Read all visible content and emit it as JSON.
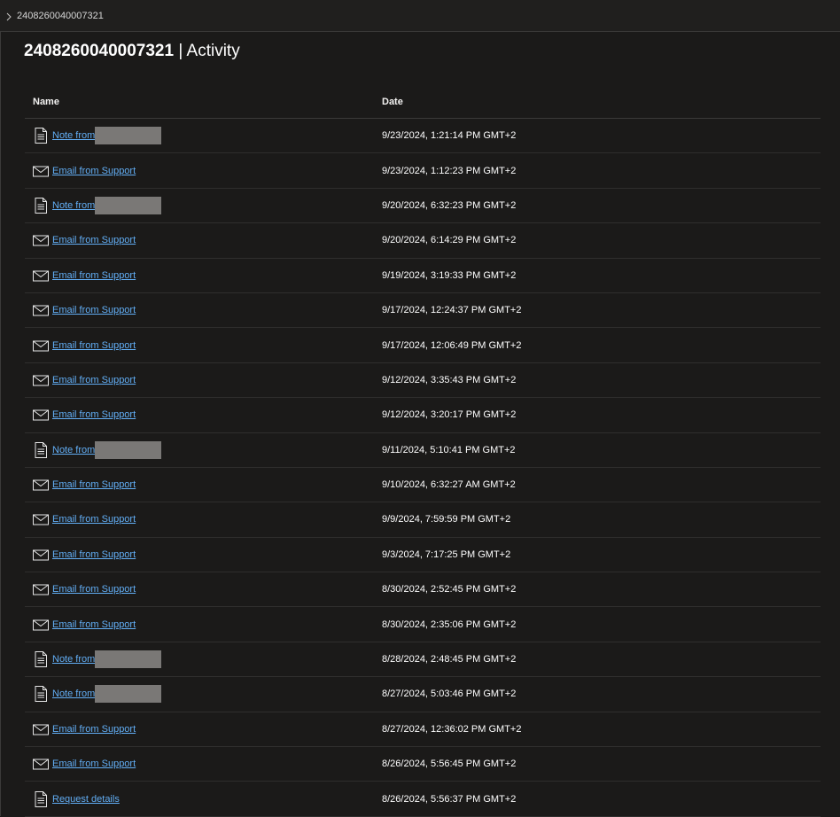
{
  "breadcrumb": {
    "label": "2408260040007321"
  },
  "header": {
    "case_number": "2408260040007321",
    "separator": " | ",
    "section": "Activity"
  },
  "table": {
    "columns": {
      "name": "Name",
      "date": "Date"
    },
    "rows": [
      {
        "type": "note",
        "icon": "note-icon",
        "label": "Note from",
        "date": "9/23/2024, 1:21:14 PM GMT+2"
      },
      {
        "type": "email",
        "icon": "mail-icon",
        "label": "Email from Support",
        "date": "9/23/2024, 1:12:23 PM GMT+2"
      },
      {
        "type": "note",
        "icon": "note-icon",
        "label": "Note from",
        "date": "9/20/2024, 6:32:23 PM GMT+2"
      },
      {
        "type": "email",
        "icon": "mail-icon",
        "label": "Email from Support",
        "date": "9/20/2024, 6:14:29 PM GMT+2"
      },
      {
        "type": "email",
        "icon": "mail-icon",
        "label": "Email from Support",
        "date": "9/19/2024, 3:19:33 PM GMT+2"
      },
      {
        "type": "email",
        "icon": "mail-icon",
        "label": "Email from Support",
        "date": "9/17/2024, 12:24:37 PM GMT+2"
      },
      {
        "type": "email",
        "icon": "mail-icon",
        "label": "Email from Support",
        "date": "9/17/2024, 12:06:49 PM GMT+2"
      },
      {
        "type": "email",
        "icon": "mail-icon",
        "label": "Email from Support",
        "date": "9/12/2024, 3:35:43 PM GMT+2"
      },
      {
        "type": "email",
        "icon": "mail-icon",
        "label": "Email from Support",
        "date": "9/12/2024, 3:20:17 PM GMT+2"
      },
      {
        "type": "note",
        "icon": "note-icon",
        "label": "Note from",
        "date": "9/11/2024, 5:10:41 PM GMT+2"
      },
      {
        "type": "email",
        "icon": "mail-icon",
        "label": "Email from Support",
        "date": "9/10/2024, 6:32:27 AM GMT+2"
      },
      {
        "type": "email",
        "icon": "mail-icon",
        "label": "Email from Support",
        "date": "9/9/2024, 7:59:59 PM GMT+2"
      },
      {
        "type": "email",
        "icon": "mail-icon",
        "label": "Email from Support",
        "date": "9/3/2024, 7:17:25 PM GMT+2"
      },
      {
        "type": "email",
        "icon": "mail-icon",
        "label": "Email from Support",
        "date": "8/30/2024, 2:52:45 PM GMT+2"
      },
      {
        "type": "email",
        "icon": "mail-icon",
        "label": "Email from Support",
        "date": "8/30/2024, 2:35:06 PM GMT+2"
      },
      {
        "type": "note",
        "icon": "note-icon",
        "label": "Note from",
        "date": "8/28/2024, 2:48:45 PM GMT+2"
      },
      {
        "type": "note",
        "icon": "note-icon",
        "label": "Note from",
        "date": "8/27/2024, 5:03:46 PM GMT+2"
      },
      {
        "type": "email",
        "icon": "mail-icon",
        "label": "Email from Support",
        "date": "8/27/2024, 12:36:02 PM GMT+2"
      },
      {
        "type": "email",
        "icon": "mail-icon",
        "label": "Email from Support",
        "date": "8/26/2024, 5:56:45 PM GMT+2"
      },
      {
        "type": "document",
        "icon": "document-icon",
        "label": "Request details",
        "date": "8/26/2024, 5:56:37 PM GMT+2"
      }
    ]
  },
  "colors": {
    "background": "#1b1a19",
    "link": "#62aef5",
    "redaction": "#7a7876"
  }
}
